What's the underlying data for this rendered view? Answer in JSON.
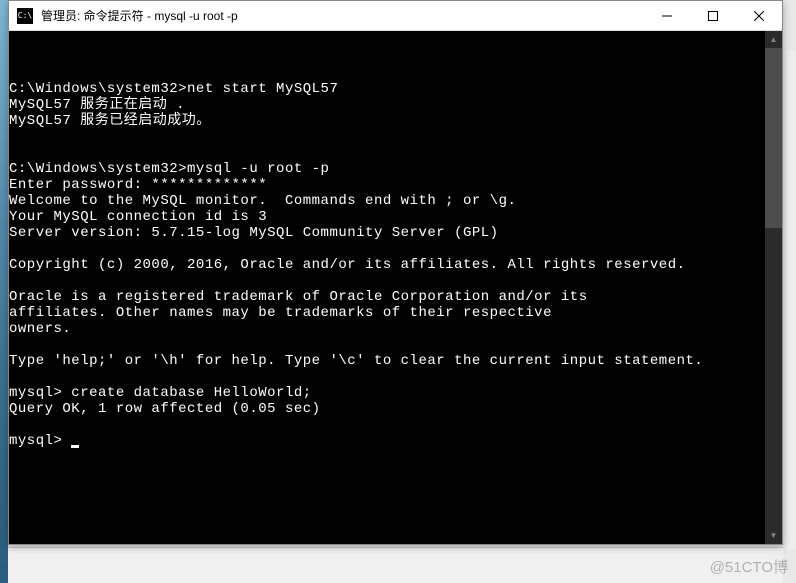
{
  "window": {
    "title_icon": "C:\\",
    "title": "管理员: 命令提示符 - mysql   -u root -p"
  },
  "terminal": {
    "lines": [
      "",
      "",
      "",
      "C:\\Windows\\system32>net start MySQL57",
      "MySQL57 服务正在启动 .",
      "MySQL57 服务已经启动成功。",
      "",
      "",
      "C:\\Windows\\system32>mysql -u root -p",
      "Enter password: *************",
      "Welcome to the MySQL monitor.  Commands end with ; or \\g.",
      "Your MySQL connection id is 3",
      "Server version: 5.7.15-log MySQL Community Server (GPL)",
      "",
      "Copyright (c) 2000, 2016, Oracle and/or its affiliates. All rights reserved.",
      "",
      "Oracle is a registered trademark of Oracle Corporation and/or its",
      "affiliates. Other names may be trademarks of their respective",
      "owners.",
      "",
      "Type 'help;' or '\\h' for help. Type '\\c' to clear the current input statement.",
      "",
      "mysql> create database HelloWorld;",
      "Query OK, 1 row affected (0.05 sec)",
      "",
      "mysql> "
    ]
  },
  "watermark": "@51CTO博"
}
